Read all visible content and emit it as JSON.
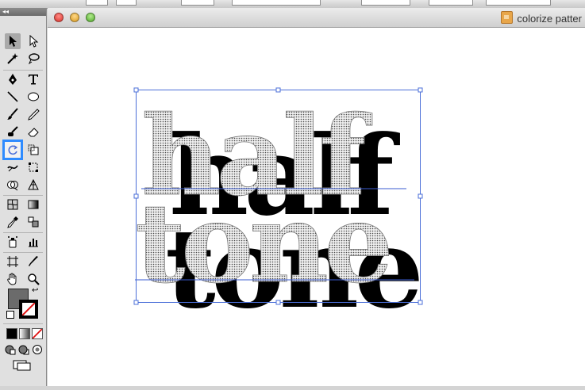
{
  "window": {
    "title": "colorize patter",
    "file_icon": "illustrator-document-icon"
  },
  "artwork": {
    "line1": "half",
    "line2": "tone",
    "fill": "halftone-dot-pattern",
    "shadow_color": "#000000",
    "selection_color": "#3366cc"
  },
  "tools_panel": {
    "collapse_glyph": "◂◂",
    "highlighted_tool": "recolor-artwork-tool",
    "accent": "#2e8bff",
    "fill_swatch": "#6b6b6b",
    "stroke_swatch": "none"
  }
}
